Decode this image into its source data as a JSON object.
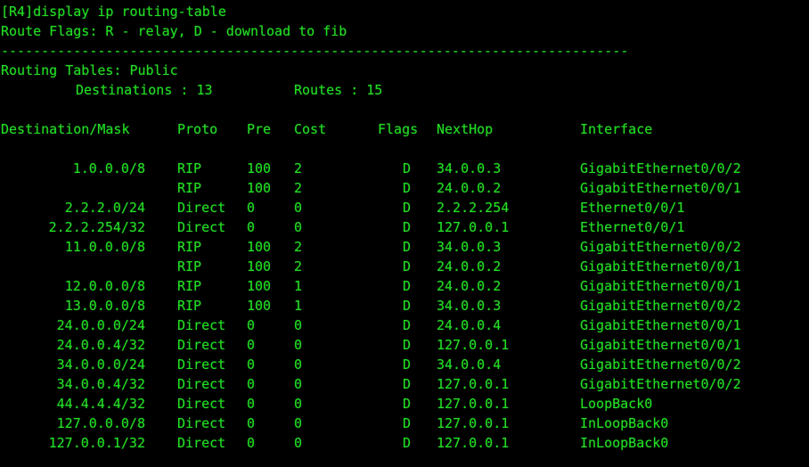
{
  "terminal": {
    "prompt_line": "[R4]display ip routing-table",
    "flags_legend": "Route Flags: R - relay, D - download to fib",
    "separator": "------------------------------------------------------------------------------",
    "table_name": "Routing Tables: Public",
    "destinations_label": "Destinations : 13",
    "routes_label": "Routes : 15",
    "colors": {
      "background": "#000000",
      "foreground": "#22dd22"
    }
  },
  "columns": {
    "destination_mask": "Destination/Mask",
    "proto": "Proto",
    "pre": "Pre",
    "cost": "Cost",
    "flags": "Flags",
    "nexthop": "NextHop",
    "interface": "Interface"
  },
  "routes": [
    {
      "destination": "1.0.0.0/8",
      "proto": "RIP",
      "pre": "100",
      "cost": "2",
      "flags": "D",
      "nexthop": "34.0.0.3",
      "interface": "GigabitEthernet0/0/2"
    },
    {
      "destination": "",
      "proto": "RIP",
      "pre": "100",
      "cost": "2",
      "flags": "D",
      "nexthop": "24.0.0.2",
      "interface": "GigabitEthernet0/0/1"
    },
    {
      "destination": "2.2.2.0/24",
      "proto": "Direct",
      "pre": "0",
      "cost": "0",
      "flags": "D",
      "nexthop": "2.2.2.254",
      "interface": "Ethernet0/0/1"
    },
    {
      "destination": "2.2.2.254/32",
      "proto": "Direct",
      "pre": "0",
      "cost": "0",
      "flags": "D",
      "nexthop": "127.0.0.1",
      "interface": "Ethernet0/0/1"
    },
    {
      "destination": "11.0.0.0/8",
      "proto": "RIP",
      "pre": "100",
      "cost": "2",
      "flags": "D",
      "nexthop": "34.0.0.3",
      "interface": "GigabitEthernet0/0/2"
    },
    {
      "destination": "",
      "proto": "RIP",
      "pre": "100",
      "cost": "2",
      "flags": "D",
      "nexthop": "24.0.0.2",
      "interface": "GigabitEthernet0/0/1"
    },
    {
      "destination": "12.0.0.0/8",
      "proto": "RIP",
      "pre": "100",
      "cost": "1",
      "flags": "D",
      "nexthop": "24.0.0.2",
      "interface": "GigabitEthernet0/0/1"
    },
    {
      "destination": "13.0.0.0/8",
      "proto": "RIP",
      "pre": "100",
      "cost": "1",
      "flags": "D",
      "nexthop": "34.0.0.3",
      "interface": "GigabitEthernet0/0/2"
    },
    {
      "destination": "24.0.0.0/24",
      "proto": "Direct",
      "pre": "0",
      "cost": "0",
      "flags": "D",
      "nexthop": "24.0.0.4",
      "interface": "GigabitEthernet0/0/1"
    },
    {
      "destination": "24.0.0.4/32",
      "proto": "Direct",
      "pre": "0",
      "cost": "0",
      "flags": "D",
      "nexthop": "127.0.0.1",
      "interface": "GigabitEthernet0/0/1"
    },
    {
      "destination": "34.0.0.0/24",
      "proto": "Direct",
      "pre": "0",
      "cost": "0",
      "flags": "D",
      "nexthop": "34.0.0.4",
      "interface": "GigabitEthernet0/0/2"
    },
    {
      "destination": "34.0.0.4/32",
      "proto": "Direct",
      "pre": "0",
      "cost": "0",
      "flags": "D",
      "nexthop": "127.0.0.1",
      "interface": "GigabitEthernet0/0/2"
    },
    {
      "destination": "44.4.4.4/32",
      "proto": "Direct",
      "pre": "0",
      "cost": "0",
      "flags": "D",
      "nexthop": "127.0.0.1",
      "interface": "LoopBack0"
    },
    {
      "destination": "127.0.0.0/8",
      "proto": "Direct",
      "pre": "0",
      "cost": "0",
      "flags": "D",
      "nexthop": "127.0.0.1",
      "interface": "InLoopBack0"
    },
    {
      "destination": "127.0.0.1/32",
      "proto": "Direct",
      "pre": "0",
      "cost": "0",
      "flags": "D",
      "nexthop": "127.0.0.1",
      "interface": "InLoopBack0"
    }
  ]
}
